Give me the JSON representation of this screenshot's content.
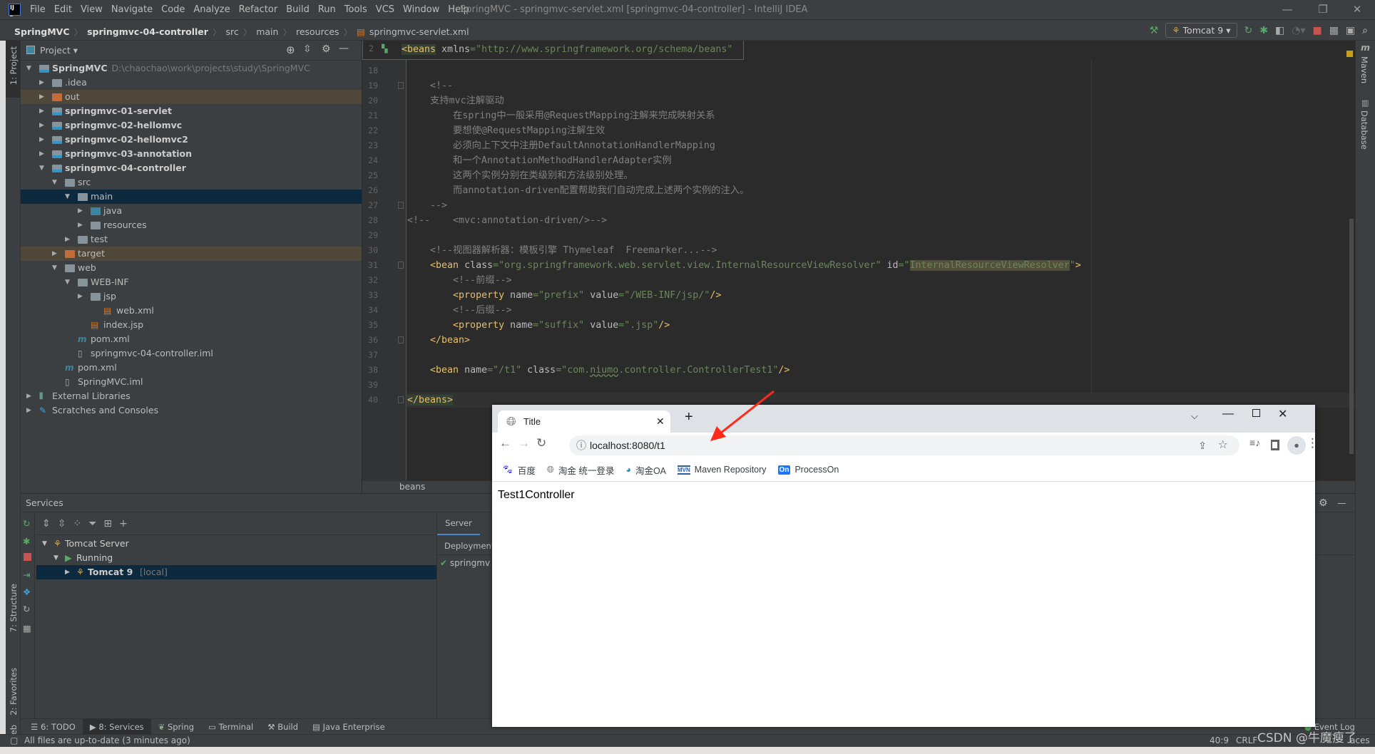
{
  "window": {
    "title": "SpringMVC - springmvc-servlet.xml [springmvc-04-controller] - IntelliJ IDEA",
    "logo": "IJ"
  },
  "menu": [
    "File",
    "Edit",
    "View",
    "Navigate",
    "Code",
    "Analyze",
    "Refactor",
    "Build",
    "Run",
    "Tools",
    "VCS",
    "Window",
    "Help"
  ],
  "breadcrumb": [
    "SpringMVC",
    "springmvc-04-controller",
    "src",
    "main",
    "resources",
    "springmvc-servlet.xml"
  ],
  "toolbar": {
    "run_config": "Tomcat 9"
  },
  "left_stripe": {
    "project": "1: Project",
    "structure": "7: Structure",
    "favorites": "2: Favorites",
    "web": "Web"
  },
  "right_stripe": {
    "maven": "Maven",
    "database": "Database"
  },
  "project": {
    "header": "Project",
    "rows": [
      {
        "label": "SpringMVC",
        "path": "D:\\chaochao\\work\\projects\\study\\SpringMVC",
        "level": 0,
        "arrow": "down",
        "bold": true,
        "icon": "module"
      },
      {
        "label": ".idea",
        "level": 1,
        "arrow": "right",
        "icon": "folder"
      },
      {
        "label": "out",
        "level": 1,
        "arrow": "right",
        "icon": "excluded",
        "state": "excluded"
      },
      {
        "label": "springmvc-01-servlet",
        "level": 1,
        "arrow": "right",
        "bold": true,
        "icon": "module"
      },
      {
        "label": "springmvc-02-hellomvc",
        "level": 1,
        "arrow": "right",
        "bold": true,
        "icon": "module"
      },
      {
        "label": "springmvc-02-hellomvc2",
        "level": 1,
        "arrow": "right",
        "bold": true,
        "icon": "module"
      },
      {
        "label": "springmvc-03-annotation",
        "level": 1,
        "arrow": "right",
        "bold": true,
        "icon": "module"
      },
      {
        "label": "springmvc-04-controller",
        "level": 1,
        "arrow": "down",
        "bold": true,
        "icon": "module"
      },
      {
        "label": "src",
        "level": 2,
        "arrow": "down",
        "icon": "folder"
      },
      {
        "label": "main",
        "level": 3,
        "arrow": "down",
        "icon": "folder",
        "state": "selected"
      },
      {
        "label": "java",
        "level": 4,
        "arrow": "right",
        "icon": "source"
      },
      {
        "label": "resources",
        "level": 4,
        "arrow": "right",
        "icon": "resources"
      },
      {
        "label": "test",
        "level": 3,
        "arrow": "right",
        "icon": "folder"
      },
      {
        "label": "target",
        "level": 2,
        "arrow": "right",
        "icon": "excluded",
        "state": "excluded"
      },
      {
        "label": "web",
        "level": 2,
        "arrow": "down",
        "icon": "web"
      },
      {
        "label": "WEB-INF",
        "level": 3,
        "arrow": "down",
        "icon": "folder"
      },
      {
        "label": "jsp",
        "level": 4,
        "arrow": "right",
        "icon": "folder"
      },
      {
        "label": "web.xml",
        "level": 5,
        "arrow": "none",
        "icon": "xml"
      },
      {
        "label": "index.jsp",
        "level": 4,
        "arrow": "none",
        "icon": "jsp"
      },
      {
        "label": "pom.xml",
        "level": 3,
        "arrow": "none",
        "icon": "maven"
      },
      {
        "label": "springmvc-04-controller.iml",
        "level": 3,
        "arrow": "none",
        "icon": "iml"
      },
      {
        "label": "pom.xml",
        "level": 2,
        "arrow": "none",
        "icon": "maven"
      },
      {
        "label": "SpringMVC.iml",
        "level": 2,
        "arrow": "none",
        "icon": "iml"
      },
      {
        "label": "External Libraries",
        "level": 0,
        "arrow": "right",
        "icon": "libraries"
      },
      {
        "label": "Scratches and Consoles",
        "level": 0,
        "arrow": "right",
        "icon": "scratches"
      }
    ]
  },
  "editor": {
    "sticky": {
      "line": "2",
      "tokens": [
        {
          "t": "<beans",
          "c": "tagb"
        },
        {
          "t": " xmlns",
          "c": "attr"
        },
        {
          "t": "=\"http://www.springframework.org/schema/beans\"",
          "c": "val"
        }
      ]
    },
    "current_line": "40",
    "lines": [
      {
        "n": "18",
        "tokens": []
      },
      {
        "n": "19",
        "fold": true,
        "tokens": [
          {
            "t": "    <!--",
            "c": "com"
          }
        ]
      },
      {
        "n": "20",
        "tokens": [
          {
            "t": "    支持mvc注解驱动",
            "c": "com"
          }
        ]
      },
      {
        "n": "21",
        "tokens": [
          {
            "t": "        在spring中一般采用@RequestMapping注解来完成映射关系",
            "c": "com"
          }
        ]
      },
      {
        "n": "22",
        "tokens": [
          {
            "t": "        要想使@RequestMapping注解生效",
            "c": "com"
          }
        ]
      },
      {
        "n": "23",
        "tokens": [
          {
            "t": "        必须向上下文中注册DefaultAnnotationHandlerMapping",
            "c": "com"
          }
        ]
      },
      {
        "n": "24",
        "tokens": [
          {
            "t": "        和一个AnnotationMethodHandlerAdapter实例",
            "c": "com"
          }
        ]
      },
      {
        "n": "25",
        "tokens": [
          {
            "t": "        这两个实例分别在类级别和方法级别处理。",
            "c": "com"
          }
        ]
      },
      {
        "n": "26",
        "tokens": [
          {
            "t": "        而annotation-driven配置帮助我们自动完成上述两个实例的注入。",
            "c": "com"
          }
        ]
      },
      {
        "n": "27",
        "fold": true,
        "tokens": [
          {
            "t": "    -->",
            "c": "com"
          }
        ]
      },
      {
        "n": "28",
        "tokens": [
          {
            "t": "<!--    <mvc:annotation-driven/>-->",
            "c": "com"
          }
        ]
      },
      {
        "n": "29",
        "tokens": []
      },
      {
        "n": "30",
        "tokens": [
          {
            "t": "    <!--视图器解析器：模板引擎 Thymeleaf  Freemarker...-->",
            "c": "com"
          }
        ]
      },
      {
        "n": "31",
        "fold": true,
        "tokens": [
          {
            "t": "    <bean",
            "c": "tag"
          },
          {
            "t": " class",
            "c": "attr"
          },
          {
            "t": "=\"org.springframework.web.servlet.view.InternalResourceViewResolver\"",
            "c": "val"
          },
          {
            "t": " id",
            "c": "attr"
          },
          {
            "t": "=\"",
            "c": "val"
          },
          {
            "t": "InternalResourceViewResolver",
            "c": "val hl"
          },
          {
            "t": "\"",
            "c": "val"
          },
          {
            "t": ">",
            "c": "tag"
          }
        ]
      },
      {
        "n": "32",
        "tokens": [
          {
            "t": "        <!--前缀-->",
            "c": "com"
          }
        ]
      },
      {
        "n": "33",
        "tokens": [
          {
            "t": "        <property",
            "c": "tag"
          },
          {
            "t": " name",
            "c": "attr"
          },
          {
            "t": "=\"prefix\"",
            "c": "val"
          },
          {
            "t": " value",
            "c": "attr"
          },
          {
            "t": "=\"/WEB-INF/jsp/\"",
            "c": "val"
          },
          {
            "t": "/>",
            "c": "tag"
          }
        ]
      },
      {
        "n": "34",
        "tokens": [
          {
            "t": "        <!--后缀-->",
            "c": "com"
          }
        ]
      },
      {
        "n": "35",
        "tokens": [
          {
            "t": "        <property",
            "c": "tag"
          },
          {
            "t": " name",
            "c": "attr"
          },
          {
            "t": "=\"suffix\"",
            "c": "val"
          },
          {
            "t": " value",
            "c": "attr"
          },
          {
            "t": "=\".jsp\"",
            "c": "val"
          },
          {
            "t": "/>",
            "c": "tag"
          }
        ]
      },
      {
        "n": "36",
        "fold": true,
        "tokens": [
          {
            "t": "    </bean>",
            "c": "tag"
          }
        ]
      },
      {
        "n": "37",
        "tokens": []
      },
      {
        "n": "38",
        "tokens": [
          {
            "t": "    <bean",
            "c": "tag"
          },
          {
            "t": " name",
            "c": "attr"
          },
          {
            "t": "=\"/t1\"",
            "c": "val"
          },
          {
            "t": " class",
            "c": "attr"
          },
          {
            "t": "=\"com.",
            "c": "val"
          },
          {
            "t": "niumo",
            "c": "val under"
          },
          {
            "t": ".controller.ControllerTest1\"",
            "c": "val"
          },
          {
            "t": "/>",
            "c": "tag"
          }
        ]
      },
      {
        "n": "39",
        "tokens": []
      },
      {
        "n": "40",
        "fold": true,
        "tokens": [
          {
            "t": "</beans>",
            "c": "tagb"
          }
        ]
      }
    ],
    "breadcrumb": "beans"
  },
  "services": {
    "title": "Services",
    "tree": [
      {
        "label": "Tomcat Server",
        "level": 0,
        "arrow": "down"
      },
      {
        "label": "Running",
        "level": 1,
        "arrow": "down"
      },
      {
        "label": "Tomcat 9",
        "suffix": "[local]",
        "level": 2,
        "arrow": "right",
        "selected": true
      }
    ],
    "right_tab": "Server",
    "deployment_header": "Deployment",
    "deployment_item": "springmv"
  },
  "bottom_tabs": [
    {
      "label": "6: TODO"
    },
    {
      "label": "8: Services",
      "active": true
    },
    {
      "label": "Spring"
    },
    {
      "label": "Terminal"
    },
    {
      "label": "Build"
    },
    {
      "label": "Java Enterprise"
    }
  ],
  "event_log": "Event Log",
  "status": {
    "message": "All files are up-to-date (3 minutes ago)",
    "position": "40:9",
    "line_sep": "CRLF",
    "indent_partial": "aces",
    "watermark": "CSDN @牛魔瘦了"
  },
  "browser": {
    "tab_title": "Title",
    "url": "localhost:8080/t1",
    "bookmarks": [
      {
        "label": "百度",
        "icon": "baidu-paw"
      },
      {
        "label": "淘金 统一登录",
        "icon": "globe"
      },
      {
        "label": "淘金OA",
        "icon": "oa-logo"
      },
      {
        "label": "Maven Repository",
        "icon": "mvn-logo"
      },
      {
        "label": "ProcessOn",
        "icon": "on-logo"
      }
    ],
    "content": "Test1Controller"
  },
  "colors": {
    "annotation_arrow": "#ff2a1a",
    "selection": "#0d293e",
    "excluded": "#4e473a"
  }
}
